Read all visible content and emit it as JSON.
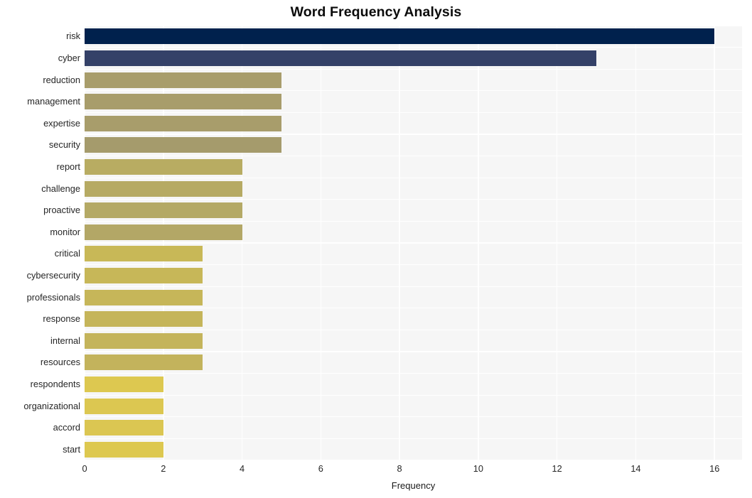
{
  "chart_data": {
    "type": "bar",
    "orientation": "horizontal",
    "title": "Word Frequency Analysis",
    "xlabel": "Frequency",
    "ylabel": "",
    "xlim": [
      0,
      16.7
    ],
    "ylim": [
      0,
      20
    ],
    "grid": true,
    "legend": false,
    "xticks": [
      "0",
      "2",
      "4",
      "6",
      "8",
      "10",
      "12",
      "14",
      "16"
    ],
    "xtick_values": [
      0,
      2,
      4,
      6,
      8,
      10,
      12,
      14,
      16
    ],
    "categories": [
      "risk",
      "cyber",
      "reduction",
      "management",
      "expertise",
      "security",
      "report",
      "challenge",
      "proactive",
      "monitor",
      "critical",
      "cybersecurity",
      "professionals",
      "response",
      "internal",
      "resources",
      "respondents",
      "organizational",
      "accord",
      "start"
    ],
    "values": [
      16,
      13,
      5,
      5,
      5,
      5,
      4,
      4,
      4,
      4,
      3,
      3,
      3,
      3,
      3,
      3,
      2,
      2,
      2,
      2
    ],
    "bar_colors": [
      "#00214d",
      "#344168",
      "#a89d6b",
      "#a89d6b",
      "#a89d6b",
      "#a59b6c",
      "#b8ac62",
      "#b6aa63",
      "#b4a965",
      "#b3a766",
      "#c8b857",
      "#c7b758",
      "#c6b659",
      "#c5b55a",
      "#c4b45b",
      "#c3b35c",
      "#ddc850",
      "#dcc751",
      "#dbc652",
      "#ddc850"
    ],
    "plot_background": "#f6f6f6",
    "figure_background": "#ffffff",
    "gridline_color": "#ffffff"
  }
}
